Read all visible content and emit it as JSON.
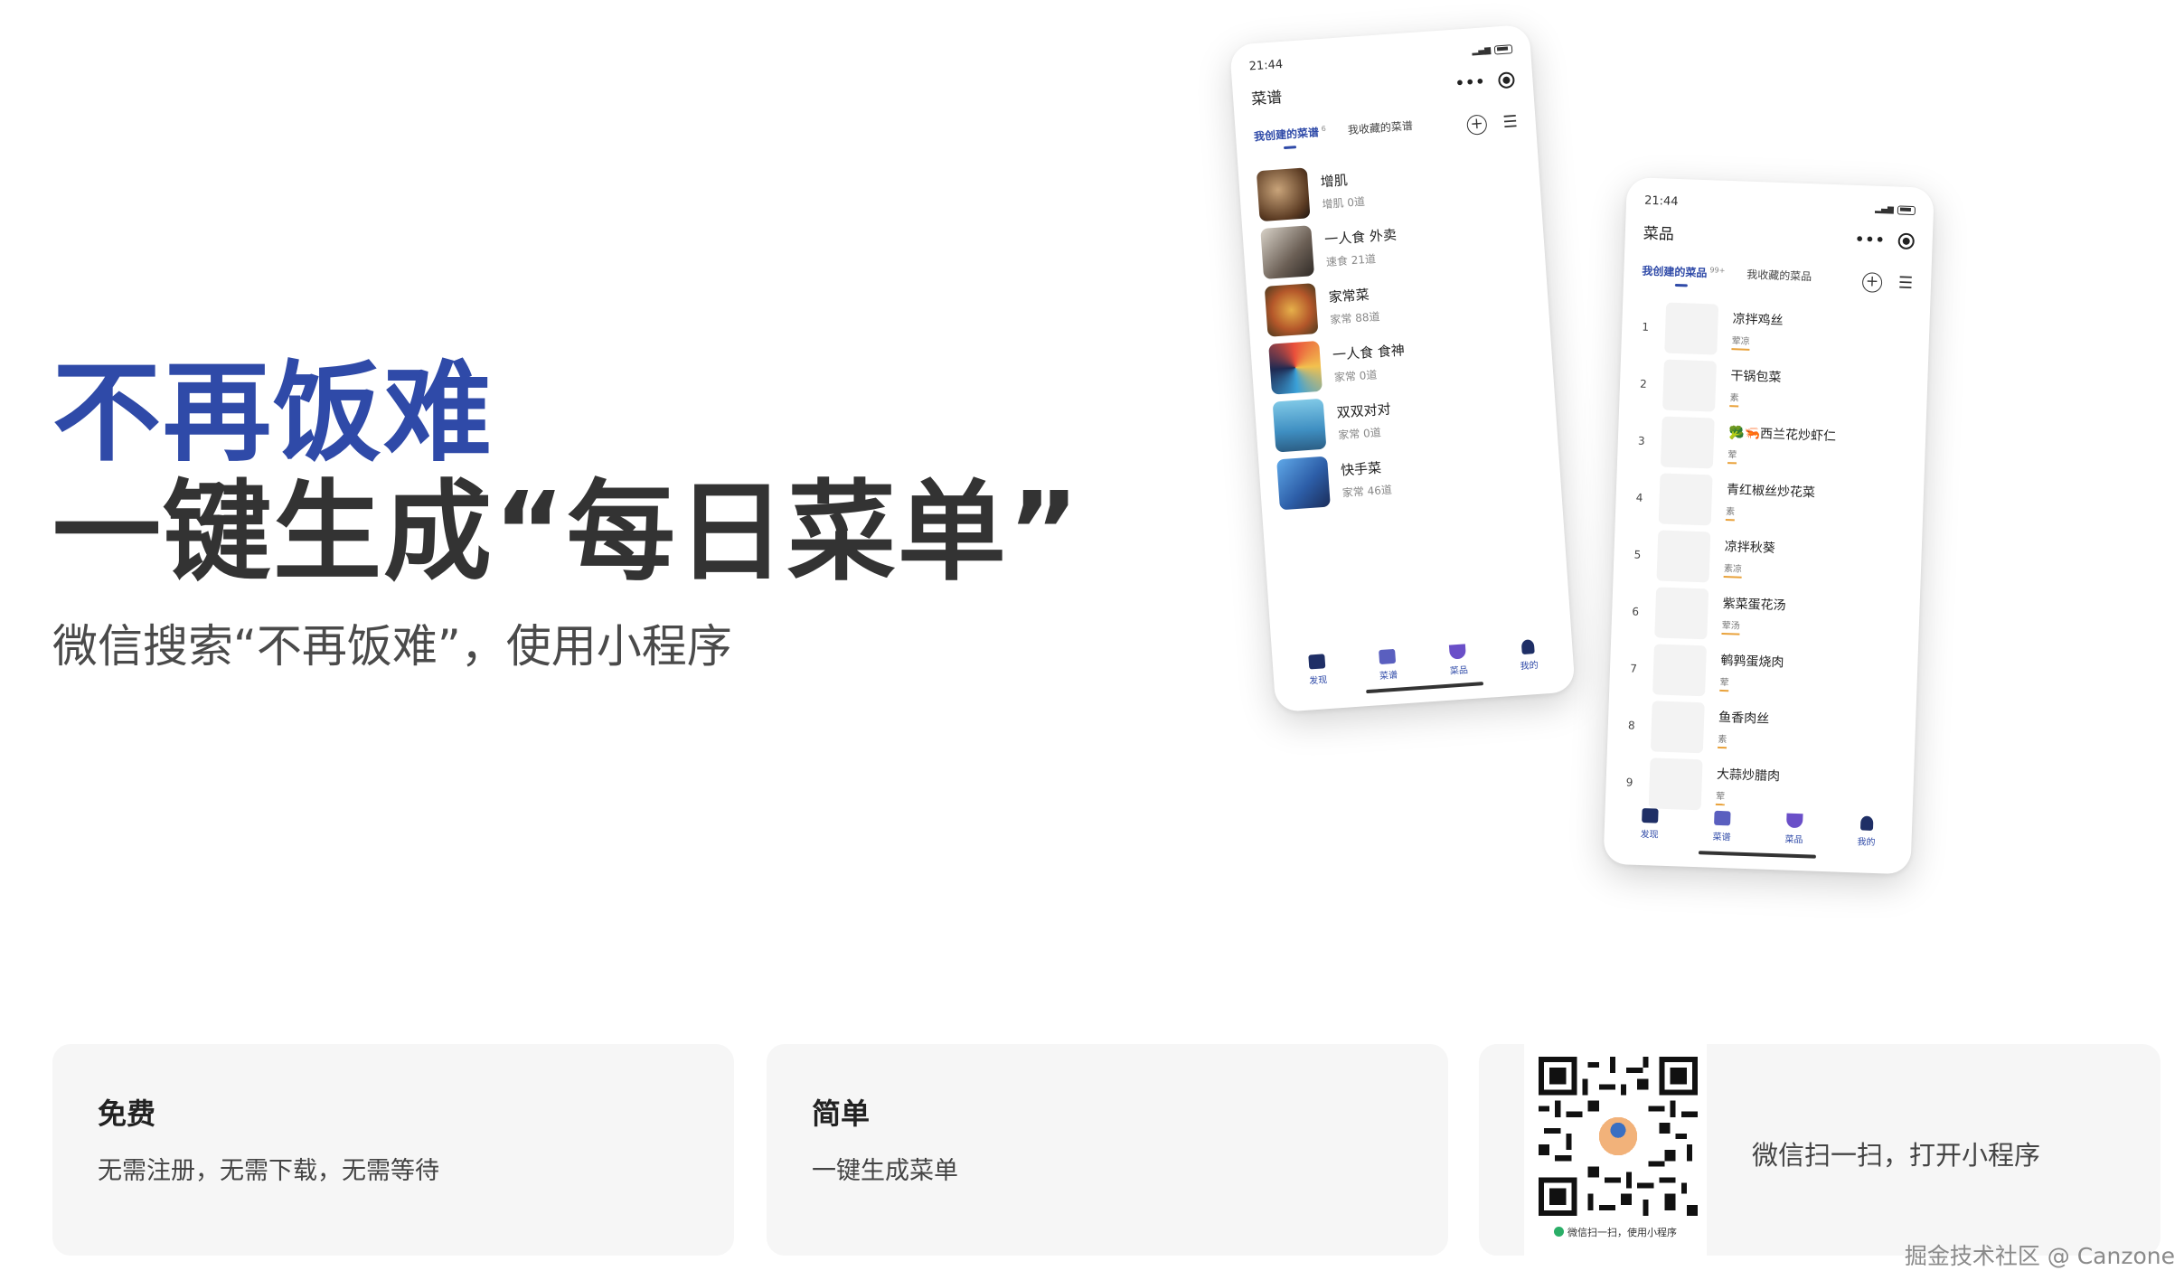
{
  "hero": {
    "title": "不再饭难",
    "subtitle": "一键生成“每日菜单”",
    "hint": "微信搜索“不再饭难”，使用小程序"
  },
  "phone_menus": {
    "time": "21:44",
    "title": "菜谱",
    "tabs": [
      {
        "label": "我创建的菜谱",
        "badge": "6"
      },
      {
        "label": "我收藏的菜谱",
        "badge": ""
      }
    ],
    "items": [
      {
        "name": "增肌",
        "meta": "增肌  0道"
      },
      {
        "name": "一人食 外卖",
        "meta": "速食  21道"
      },
      {
        "name": "家常菜",
        "meta": "家常  88道"
      },
      {
        "name": "一人食 食神",
        "meta": "家常  0道"
      },
      {
        "name": "双双对对",
        "meta": "家常  0道"
      },
      {
        "name": "快手菜",
        "meta": "家常  46道"
      }
    ],
    "tabbar": [
      "发现",
      "菜谱",
      "菜品",
      "我的"
    ]
  },
  "phone_dishes": {
    "time": "21:44",
    "title": "菜品",
    "tabs": [
      {
        "label": "我创建的菜品",
        "badge": "99+"
      },
      {
        "label": "我收藏的菜品",
        "badge": ""
      }
    ],
    "items": [
      {
        "num": "1",
        "name": "凉拌鸡丝",
        "tag": "荤凉"
      },
      {
        "num": "2",
        "name": "干锅包菜",
        "tag": "素"
      },
      {
        "num": "3",
        "name": "🥦🦐西兰花炒虾仁",
        "tag": "荤"
      },
      {
        "num": "4",
        "name": "青红椒丝炒花菜",
        "tag": "素"
      },
      {
        "num": "5",
        "name": "凉拌秋葵",
        "tag": "素凉"
      },
      {
        "num": "6",
        "name": "紫菜蛋花汤",
        "tag": "荤汤"
      },
      {
        "num": "7",
        "name": "鹌鹑蛋烧肉",
        "tag": "荤"
      },
      {
        "num": "8",
        "name": "鱼香肉丝",
        "tag": "素"
      },
      {
        "num": "9",
        "name": "大蒜炒腊肉",
        "tag": "荤"
      }
    ],
    "tabbar": [
      "发现",
      "菜谱",
      "菜品",
      "我的"
    ]
  },
  "cards": [
    {
      "title": "免费",
      "desc": "无需注册，无需下载，无需等待"
    },
    {
      "title": "简单",
      "desc": "一键生成菜单"
    }
  ],
  "qr_card": {
    "caption": "微信扫一扫，使用小程序",
    "hint": "微信扫一扫，打开小程序"
  },
  "watermark": "掘金技术社区 @ Canzone",
  "colors": {
    "accent": "#2f4aa8",
    "heading": "#333333",
    "card_bg": "#f6f6f6",
    "wechat_green": "#2aae67"
  }
}
